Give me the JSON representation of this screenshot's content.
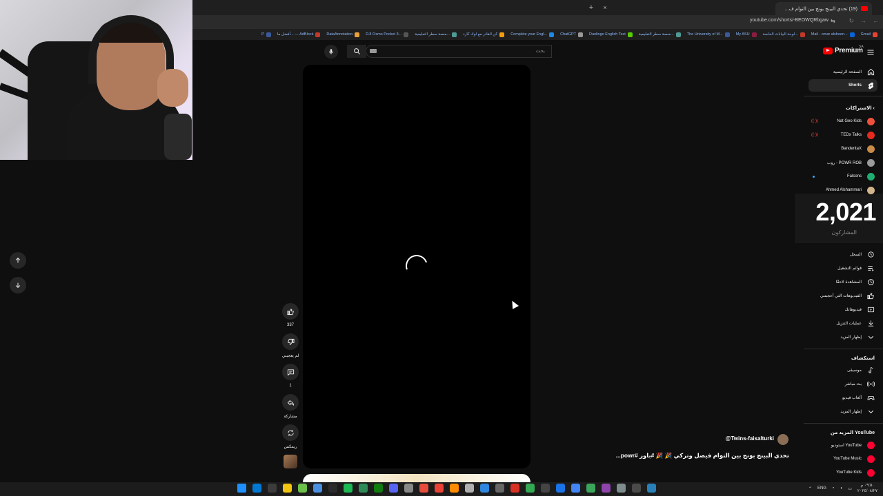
{
  "browser": {
    "tab_title": "(19) تحدي البينج بونج بين التوام ف...",
    "new_tab": "+",
    "close_tab": "×",
    "url": "youtube.com/shorts/-BEOWQRbgaw",
    "bookmarks": [
      {
        "label": "Gmail",
        "color": "#ea4335"
      },
      {
        "label": "Mail - omar alsheen...",
        "color": "#0a64d6"
      },
      {
        "label": "لوحة البيانات الخاصة...",
        "color": "#c0392b"
      },
      {
        "label": "My ASU",
        "color": "#8c1d40"
      },
      {
        "label": "The University of M...",
        "color": "#3b5998"
      },
      {
        "label": "منصة سطر التعليمية...",
        "color": "#4f9a94"
      },
      {
        "label": "Duolingo English Test",
        "color": "#58cc02"
      },
      {
        "label": "ChatGPT",
        "color": "#999999"
      },
      {
        "label": "Complete your Engl...",
        "color": "#1e88e5"
      },
      {
        "label": "كن القادر مع لوك كارد",
        "color": "#f39c12"
      },
      {
        "label": "منصة سطر التعليمية...",
        "color": "#4f9a94"
      },
      {
        "label": "DJI Osmo Pocket 3...",
        "color": "#555555"
      },
      {
        "label": "DataAnnotation",
        "color": "#e9a23b"
      },
      {
        "label": "أفضل ما... — AdBlock",
        "color": "#c0392b"
      },
      {
        "label": "P",
        "color": "#3b5998"
      }
    ]
  },
  "search": {
    "placeholder": "بحث"
  },
  "video": {
    "author": "@Twins-faisalturki",
    "title": "تحدي البينج بونج بين التوام فيصل وتركي 🎉 🎉 #باور #powr..."
  },
  "actions": {
    "like_count": "337",
    "dislike_label": "لم يعجبني",
    "comment_count": "1",
    "share_label": "مشاركة",
    "remix_label": "ريمكس"
  },
  "sidebar": {
    "logo_text": "Premium",
    "logo_region": "SA",
    "home": "الصفحة الرئيسية",
    "shorts": "Shorts",
    "subscriptions_heading": "الاشتراكات",
    "channels": [
      {
        "name": "Nat Geo Kids",
        "color": "#f0503c",
        "live": true
      },
      {
        "name": "TEDx Talks",
        "color": "#e62b1e",
        "live": true
      },
      {
        "name": "BanderitaX",
        "color": "#c98b47",
        "live": false
      },
      {
        "name": "روب - POWR ROB",
        "color": "#9b9b9b",
        "live": false
      },
      {
        "name": "Falcons",
        "color": "#1fae72",
        "live": false,
        "dot": true
      },
      {
        "name": "Ahmed Alshammari",
        "color": "#d2b48c",
        "live": false
      }
    ],
    "you_items": [
      {
        "label": "السجل",
        "icon": "history-icon"
      },
      {
        "label": "قوائم التشغيل",
        "icon": "playlists-icon"
      },
      {
        "label": "المشاهدة لاحقًا",
        "icon": "watch-later-icon"
      },
      {
        "label": "الفيديوهات التي أعجبتني",
        "icon": "liked-icon"
      },
      {
        "label": "فيديوهاتك",
        "icon": "your-videos-icon"
      },
      {
        "label": "عمليات التنزيل",
        "icon": "downloads-icon"
      },
      {
        "label": "إظهار المزيد",
        "icon": "chevron-down-icon"
      }
    ],
    "explore_heading": "استكشاف",
    "explore_items": [
      {
        "label": "موسيقى",
        "icon": "music-icon"
      },
      {
        "label": "بث مباشر",
        "icon": "live-icon"
      },
      {
        "label": "ألعاب فيديو",
        "icon": "gaming-icon"
      },
      {
        "label": "إظهار المزيد",
        "icon": "chevron-down-icon"
      }
    ],
    "more_heading": "المزيد من YouTube",
    "more_items": [
      {
        "label": "استوديو YouTube"
      },
      {
        "label": "YouTube Music"
      },
      {
        "label": "YouTube Kids"
      }
    ]
  },
  "overlay": {
    "viewer_count": "2,021",
    "viewer_label": "المشاركون"
  },
  "taskbar": {
    "language": "ENG",
    "time": "٠٩:٥٠ م",
    "date": "٢٠٢٤/٠٨/٢٧",
    "app_colors": [
      "#1e90ff",
      "#0078d4",
      "#3c3c3c",
      "#f1c40f",
      "#6cc04a",
      "#4a90e2",
      "#2c2c2c",
      "#1db954",
      "#2e8b57",
      "#107c10",
      "#5865f2",
      "#888888",
      "#e74c3c",
      "#ea4335",
      "#ff8c00",
      "#b0b0b0",
      "#2e86de",
      "#666666",
      "#d93025",
      "#34a853",
      "#444444",
      "#1a73e8",
      "#4285f4",
      "#3ba55c",
      "#8e44ad",
      "#7f8c8d",
      "#4a4a4a",
      "#2980b9"
    ]
  }
}
